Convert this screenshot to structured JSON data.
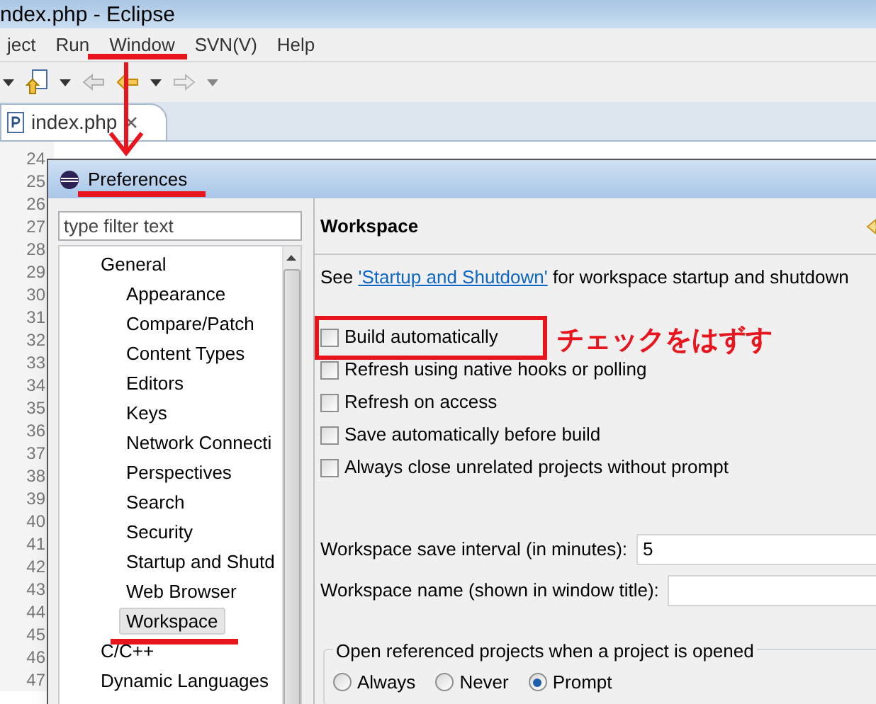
{
  "window": {
    "title": "ndex.php - Eclipse"
  },
  "menu": [
    {
      "label": "ject"
    },
    {
      "label": "Run"
    },
    {
      "label": "Window"
    },
    {
      "label": "SVN(V)"
    },
    {
      "label": "Help"
    }
  ],
  "editor_tab": {
    "label": "index.php",
    "selected": true
  },
  "line_numbers": [
    "24",
    "25",
    "26",
    "27",
    "28",
    "29",
    "30",
    "31",
    "32",
    "33",
    "34",
    "35",
    "36",
    "37",
    "38",
    "39",
    "40",
    "41",
    "42",
    "43",
    "44",
    "45",
    "46",
    "47"
  ],
  "preferences": {
    "title": "Preferences",
    "filter": {
      "placeholder": "type filter text"
    },
    "tree": [
      {
        "label": "General",
        "selected": false,
        "children": [
          {
            "label": "Appearance",
            "selected": false
          },
          {
            "label": "Compare/Patch",
            "selected": false
          },
          {
            "label": "Content Types",
            "selected": false
          },
          {
            "label": "Editors",
            "selected": false
          },
          {
            "label": "Keys",
            "selected": false
          },
          {
            "label": "Network Connecti",
            "selected": false
          },
          {
            "label": "Perspectives",
            "selected": false
          },
          {
            "label": "Search",
            "selected": false
          },
          {
            "label": "Security",
            "selected": false
          },
          {
            "label": "Startup and Shutd",
            "selected": false
          },
          {
            "label": "Web Browser",
            "selected": false
          },
          {
            "label": "Workspace",
            "selected": true
          }
        ]
      },
      {
        "label": "C/C++",
        "selected": false
      },
      {
        "label": "Dynamic Languages",
        "selected": false
      }
    ],
    "page_title": "Workspace",
    "intro": {
      "before": "See ",
      "link": "'Startup and Shutdown'",
      "after": " for workspace startup and shutdown"
    },
    "options": [
      {
        "label": "Build automatically",
        "checked": false
      },
      {
        "label": "Refresh using native hooks or polling",
        "checked": false
      },
      {
        "label": "Refresh on access",
        "checked": false
      },
      {
        "label": "Save automatically before build",
        "checked": false
      },
      {
        "label": "Always close unrelated projects without prompt",
        "checked": false
      }
    ],
    "fields": [
      {
        "label": "Workspace save interval (in minutes):",
        "value": "5"
      },
      {
        "label": "Workspace name (shown in window title):"
      }
    ],
    "group": {
      "title": "Open referenced projects when a project is opened",
      "choices": [
        {
          "label": "Always",
          "selected": false
        },
        {
          "label": "Never",
          "selected": false
        },
        {
          "label": "Prompt",
          "selected": true
        }
      ]
    }
  },
  "annotation": {
    "note": "チェックをはずす"
  }
}
